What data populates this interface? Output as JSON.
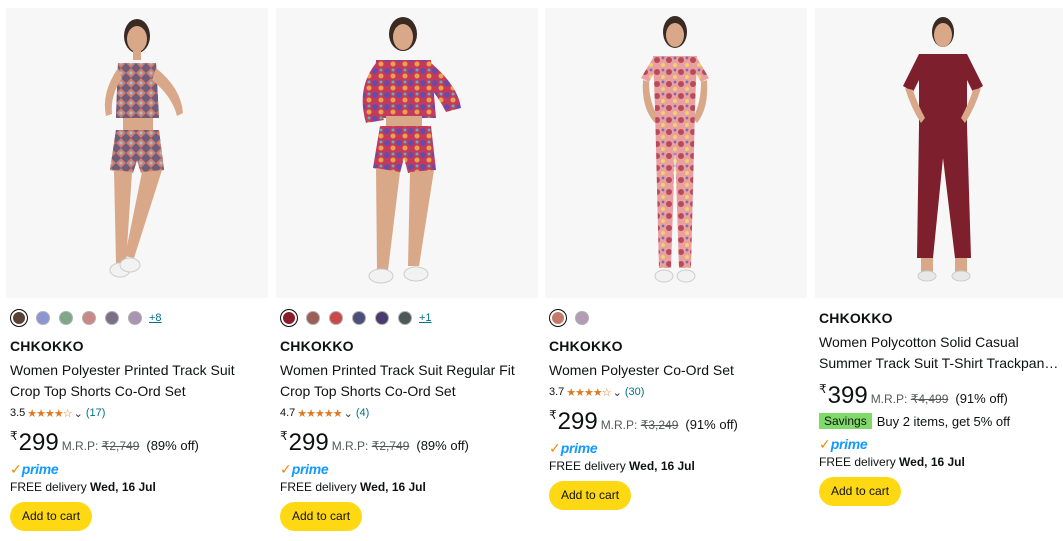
{
  "products": [
    {
      "brand": "CHKOKKO",
      "title": "Women Polyester Printed Track Suit Crop Top Shorts Co-Ord Set",
      "swatches": [
        "#5b4236",
        "#8d96d3",
        "#7fa88a",
        "#c98a86",
        "#7d7086",
        "#a995b1"
      ],
      "more_colors": "+8",
      "rating": "3.5",
      "stars": "★★★★☆",
      "reviews": "(17)",
      "currency": "₹",
      "price": "299",
      "mrp_label": "M.R.P:",
      "mrp": "₹2,749",
      "discount": "(89% off)",
      "prime": "prime",
      "delivery_label": "FREE delivery",
      "delivery_date": "Wed, 16 Jul",
      "cart_label": "Add to cart"
    },
    {
      "brand": "CHKOKKO",
      "title": "Women Printed Track Suit Regular Fit Crop Top Shorts Co-Ord Set",
      "swatches": [
        "#8b1d2b",
        "#9a5f55",
        "#c94a4a",
        "#4b4f7a",
        "#4a3a6e",
        "#4b5a58"
      ],
      "more_colors": "+1",
      "rating": "4.7",
      "stars": "★★★★★",
      "reviews": "(4)",
      "currency": "₹",
      "price": "299",
      "mrp_label": "M.R.P:",
      "mrp": "₹2,749",
      "discount": "(89% off)",
      "prime": "prime",
      "delivery_label": "FREE delivery",
      "delivery_date": "Wed, 16 Jul",
      "cart_label": "Add to cart"
    },
    {
      "brand": "CHKOKKO",
      "title": "Women Polyester Co-Ord Set",
      "swatches": [
        "#c47a6a",
        "#b49bb6"
      ],
      "more_colors": "",
      "rating": "3.7",
      "stars": "★★★★☆",
      "reviews": "(30)",
      "currency": "₹",
      "price": "299",
      "mrp_label": "M.R.P:",
      "mrp": "₹3,249",
      "discount": "(91% off)",
      "prime": "prime",
      "delivery_label": "FREE delivery",
      "delivery_date": "Wed, 16 Jul",
      "cart_label": "Add to cart"
    },
    {
      "brand": "CHKOKKO",
      "title": "Women Polycotton Solid Casual Summer Track Suit T-Shirt Trackpan…",
      "swatches": [],
      "more_colors": "",
      "rating": "",
      "stars": "",
      "reviews": "",
      "currency": "₹",
      "price": "399",
      "mrp_label": "M.R.P:",
      "mrp": "₹4,499",
      "discount": "(91% off)",
      "savings_badge": "Savings",
      "savings_text": "Buy 2 items, get 5% off",
      "prime": "prime",
      "delivery_label": "FREE delivery",
      "delivery_date": "Wed, 16 Jul",
      "cart_label": "Add to cart"
    }
  ],
  "colors": {
    "cart_button": "#ffd814",
    "star": "#de7921",
    "link": "#007185",
    "prime_blue": "#1399ff",
    "prime_tick": "#f08804",
    "savings_badge": "#7fda69"
  }
}
